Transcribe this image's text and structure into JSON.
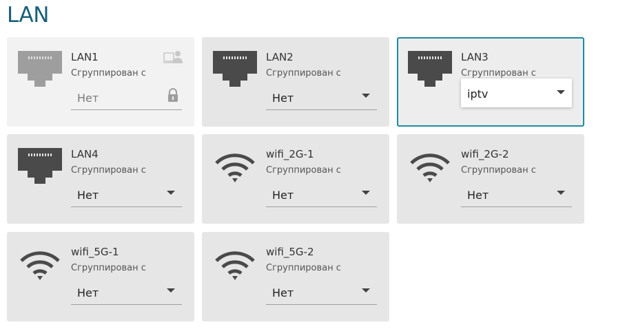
{
  "page": {
    "title": "LAN"
  },
  "colors": {
    "title": "#1a5f78",
    "card_bg": "#e6e6e6",
    "card_disabled_bg": "#f2f2f2",
    "selected_border": "#1d8aa3",
    "icon_dark": "#4a4a4a",
    "icon_disabled": "#9e9e9e"
  },
  "ports": [
    {
      "name": "LAN1",
      "group_label": "Сгруппирован с",
      "value": "Нет",
      "icon": "ethernet-port-icon",
      "state": "disabled"
    },
    {
      "name": "LAN2",
      "group_label": "Сгруппирован с",
      "value": "Нет",
      "icon": "ethernet-port-icon",
      "state": "normal"
    },
    {
      "name": "LAN3",
      "group_label": "Сгруппирован с",
      "value": "iptv",
      "icon": "ethernet-port-icon",
      "state": "selected"
    },
    {
      "name": "LAN4",
      "group_label": "Сгруппирован с",
      "value": "Нет",
      "icon": "ethernet-port-icon",
      "state": "normal"
    },
    {
      "name": "wifi_2G-1",
      "group_label": "Сгруппирован с",
      "value": "Нет",
      "icon": "wifi-icon",
      "state": "normal"
    },
    {
      "name": "wifi_2G-2",
      "group_label": "Сгруппирован с",
      "value": "Нет",
      "icon": "wifi-icon",
      "state": "normal"
    },
    {
      "name": "wifi_5G-1",
      "group_label": "Сгруппирован с",
      "value": "Нет",
      "icon": "wifi-icon",
      "state": "normal"
    },
    {
      "name": "wifi_5G-2",
      "group_label": "Сгруппирован с",
      "value": "Нет",
      "icon": "wifi-icon",
      "state": "normal"
    }
  ]
}
